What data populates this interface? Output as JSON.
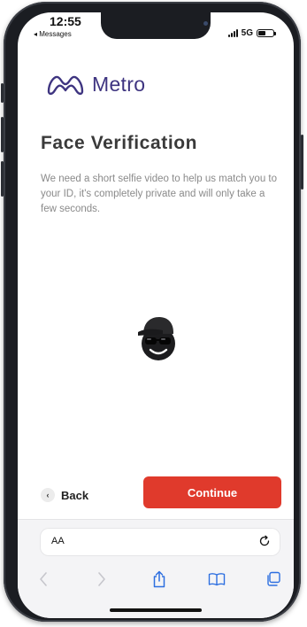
{
  "status_bar": {
    "time": "12:55",
    "back_app": "◂ Messages",
    "network": "5G",
    "battery_level": 0.5
  },
  "brand": {
    "name": "Metro",
    "color": "#3e3480"
  },
  "page": {
    "title": "Face Verification",
    "description": "We need a short selfie video to help us match you to your ID, it's completely private and will only take a few seconds."
  },
  "avatar": {
    "icon": "face-avatar-icon"
  },
  "actions": {
    "back_icon": "‹",
    "back_label": "Back",
    "continue_label": "Continue",
    "continue_color": "#e03a2c"
  },
  "browser": {
    "text_size_label": "AA",
    "nav_icons": [
      "back-arrow-icon",
      "forward-arrow-icon",
      "share-icon",
      "bookmarks-icon",
      "tabs-icon"
    ]
  }
}
